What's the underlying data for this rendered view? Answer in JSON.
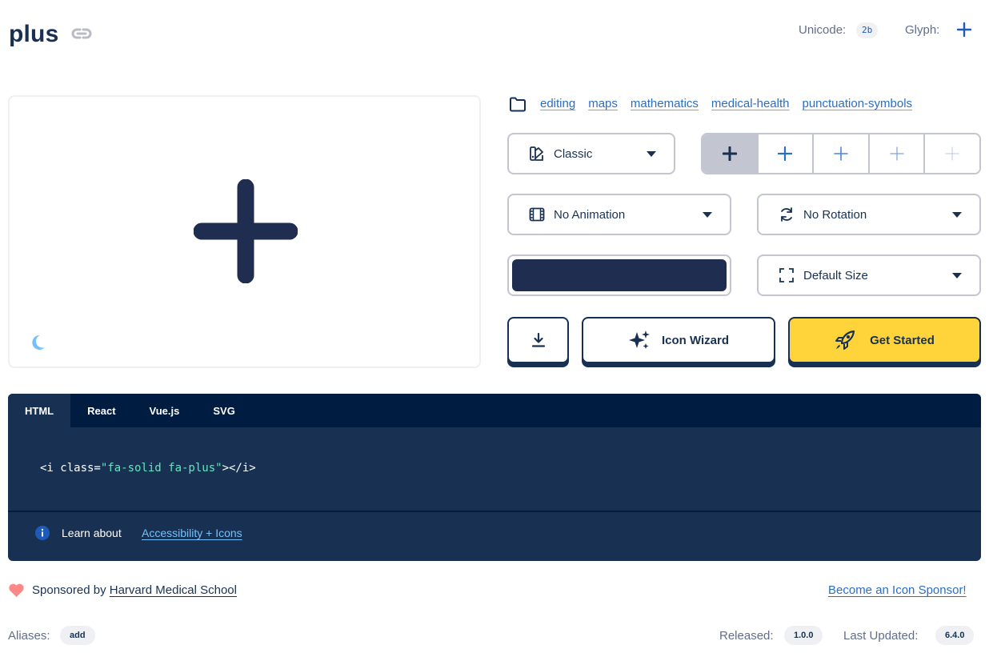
{
  "icon": {
    "name": "plus",
    "unicode_label": "Unicode:",
    "unicode": "2b",
    "glyph_label": "Glyph:"
  },
  "categories": [
    "editing",
    "maps",
    "mathematics",
    "medical-health",
    "punctuation-symbols"
  ],
  "controls": {
    "style": "Classic",
    "animation": "No Animation",
    "rotation": "No Rotation",
    "size": "Default Size",
    "selected_color": "#1f2d50",
    "wizard_label": "Icon Wizard",
    "get_started_label": "Get Started"
  },
  "code": {
    "tabs": [
      "HTML",
      "React",
      "Vue.js",
      "SVG"
    ],
    "active_tab": "HTML",
    "snippet_open": "<i class=",
    "snippet_string": "\"fa-solid fa-plus\"",
    "snippet_close": "></i>",
    "learn_about": "Learn about",
    "learn_link": "Accessibility + Icons"
  },
  "sponsor": {
    "prefix": "Sponsored by",
    "name": "Harvard Medical School",
    "become_link": "Become an Icon Sponsor!"
  },
  "meta": {
    "aliases_label": "Aliases:",
    "alias": "add",
    "released_label": "Released:",
    "released": "1.0.0",
    "updated_label": "Last Updated:",
    "updated": "6.4.0"
  },
  "colors": {
    "brand_navy": "#183153",
    "accent_yellow": "#ffd43b",
    "link_blue": "#2a6ec5",
    "code_string": "#63e6be"
  }
}
